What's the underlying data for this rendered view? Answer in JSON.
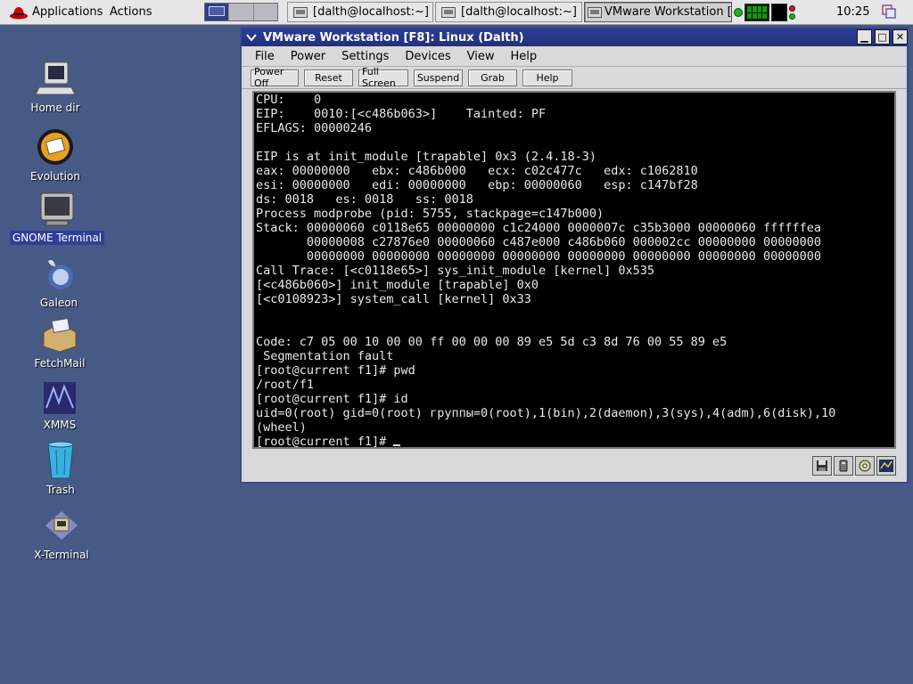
{
  "panel": {
    "menus": [
      "Applications",
      "Actions"
    ],
    "tasks": [
      {
        "label": "[dalth@localhost:~]",
        "active": false
      },
      {
        "label": "[dalth@localhost:~]",
        "active": false
      },
      {
        "label": "VMware Workstation [F8]",
        "active": true
      }
    ],
    "clock": "10:25"
  },
  "desktop": {
    "icons": [
      {
        "label": "Home dir",
        "icon": "computer-icon",
        "selected": false
      },
      {
        "label": "Evolution",
        "icon": "evolution-icon",
        "selected": false
      },
      {
        "label": "GNOME Terminal",
        "icon": "terminal-icon",
        "selected": true
      },
      {
        "label": "Galeon",
        "icon": "galeon-icon",
        "selected": false
      },
      {
        "label": "FetchMail",
        "icon": "mail-package-icon",
        "selected": false
      },
      {
        "label": "XMMS",
        "icon": "xmms-icon",
        "selected": false
      },
      {
        "label": "Trash",
        "icon": "trash-icon",
        "selected": false
      },
      {
        "label": "X-Terminal",
        "icon": "x-terminal-icon",
        "selected": false
      }
    ]
  },
  "window": {
    "title": "VMware Workstation [F8]: Linux (Dalth)",
    "menus": [
      "File",
      "Power",
      "Settings",
      "Devices",
      "View",
      "Help"
    ],
    "toolbar": [
      "Power Off",
      "Reset",
      "Full Screen",
      "Suspend",
      "Grab",
      "Help"
    ],
    "console_lines": [
      "CPU:    0",
      "EIP:    0010:[<c486b063>]    Tainted: PF",
      "EFLAGS: 00000246",
      "",
      "EIP is at init_module [trapable] 0x3 (2.4.18-3)",
      "eax: 00000000   ebx: c486b000   ecx: c02c477c   edx: c1062810",
      "esi: 00000000   edi: 00000000   ebp: 00000060   esp: c147bf28",
      "ds: 0018   es: 0018   ss: 0018",
      "Process modprobe (pid: 5755, stackpage=c147b000)",
      "Stack: 00000060 c0118e65 00000000 c1c24000 0000007c c35b3000 00000060 ffffffea",
      "       00000008 c27876e0 00000060 c487e000 c486b060 000002cc 00000000 00000000",
      "       00000000 00000000 00000000 00000000 00000000 00000000 00000000 00000000",
      "Call Trace: [<c0118e65>] sys_init_module [kernel] 0x535",
      "[<c486b060>] init_module [trapable] 0x0",
      "[<c0108923>] system_call [kernel] 0x33",
      "",
      "",
      "Code: c7 05 00 10 00 00 ff 00 00 00 89 e5 5d c3 8d 76 00 55 89 e5",
      " Segmentation fault",
      "[root@current f1]# pwd",
      "/root/f1",
      "[root@current f1]# id",
      "uid=0(root) gid=0(root) группы=0(root),1(bin),2(daemon),3(sys),4(adm),6(disk),10",
      "(wheel)"
    ],
    "prompt": "[root@current f1]# "
  }
}
